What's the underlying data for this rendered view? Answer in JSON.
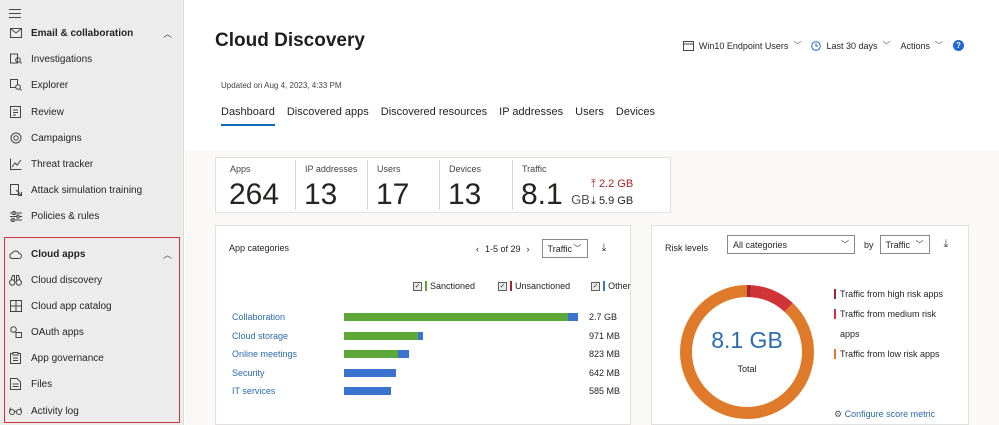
{
  "sidebar": {
    "items": [
      {
        "label": "Email & collaboration",
        "icon": "mail-icon",
        "group": true,
        "chevron": "︿"
      },
      {
        "label": "Investigations",
        "icon": "investigations-icon"
      },
      {
        "label": "Explorer",
        "icon": "explorer-icon"
      },
      {
        "label": "Review",
        "icon": "review-icon"
      },
      {
        "label": "Campaigns",
        "icon": "campaigns-icon"
      },
      {
        "label": "Threat tracker",
        "icon": "threat-tracker-icon"
      },
      {
        "label": "Attack simulation training",
        "icon": "attack-simulation-icon"
      },
      {
        "label": "Policies & rules",
        "icon": "policies-icon"
      },
      {
        "label": "Cloud apps",
        "icon": "cloud-icon",
        "group": true,
        "chevron": "︿"
      },
      {
        "label": "Cloud discovery",
        "icon": "binoculars-icon"
      },
      {
        "label": "Cloud app catalog",
        "icon": "catalog-icon"
      },
      {
        "label": "OAuth apps",
        "icon": "oauth-icon"
      },
      {
        "label": "App governance",
        "icon": "governance-icon"
      },
      {
        "label": "Files",
        "icon": "files-icon"
      },
      {
        "label": "Activity log",
        "icon": "glasses-icon"
      }
    ]
  },
  "header": {
    "title": "Cloud Discovery",
    "updated": "Updated on Aug 4, 2023, 4:33 PM",
    "report": "Win10 Endpoint Users",
    "range": "Last 30 days",
    "actions": "Actions",
    "help": "?"
  },
  "tabs": [
    "Dashboard",
    "Discovered apps",
    "Discovered resources",
    "IP addresses",
    "Users",
    "Devices"
  ],
  "stats": {
    "apps": {
      "label": "Apps",
      "value": "264"
    },
    "ips": {
      "label": "IP addresses",
      "value": "13"
    },
    "users": {
      "label": "Users",
      "value": "17"
    },
    "devices": {
      "label": "Devices",
      "value": "13"
    },
    "traffic": {
      "label": "Traffic",
      "value": "8.1",
      "unit": "GB",
      "up": "2.2 GB",
      "down": "5.9 GB"
    }
  },
  "app_categories": {
    "title": "App categories",
    "pager": "1-5 of 29",
    "metric": "Traffic",
    "legend": [
      {
        "label": "Sanctioned",
        "color": "#5ea83a"
      },
      {
        "label": "Unsanctioned",
        "color": "#a4262c"
      },
      {
        "label": "Other",
        "color": "#3b73d1"
      }
    ],
    "rows": [
      {
        "name": "Collaboration",
        "value": "2.7 GB",
        "sanctioned": 0.91,
        "other": 0.04
      },
      {
        "name": "Cloud storage",
        "value": "971 MB",
        "sanctioned": 0.3,
        "other": 0.02
      },
      {
        "name": "Online meetings",
        "value": "823 MB",
        "sanctioned": 0.22,
        "other": 0.045
      },
      {
        "name": "Security",
        "value": "642 MB",
        "sanctioned": 0.0,
        "other": 0.21
      },
      {
        "name": "IT services",
        "value": "585 MB",
        "sanctioned": 0.0,
        "other": 0.19
      }
    ]
  },
  "risk_levels": {
    "title": "Risk levels",
    "category": "All categories",
    "by": "by",
    "metric": "Traffic",
    "total_value": "8.1 GB",
    "total_label": "Total",
    "segments": [
      {
        "label": "Traffic from high risk apps",
        "color": "#a4262c",
        "fraction": 0.01
      },
      {
        "label": "Traffic from medium risk apps",
        "color": "#d13438",
        "fraction": 0.11
      },
      {
        "label": "Traffic from low risk apps",
        "color": "#e07a2b",
        "fraction": 0.88
      }
    ],
    "configure": "Configure score metric"
  }
}
